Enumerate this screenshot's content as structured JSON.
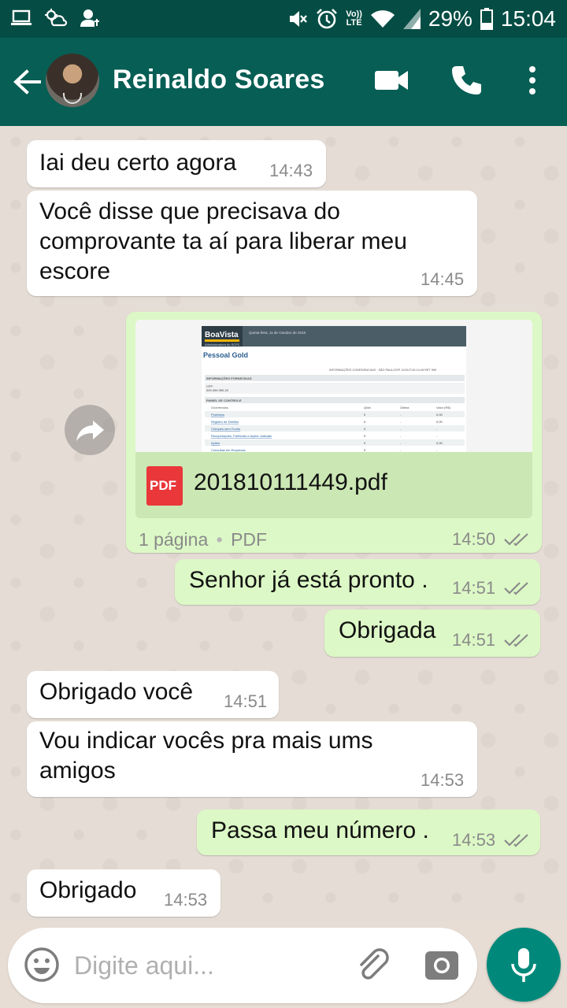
{
  "status_bar": {
    "volte_top": "Vo))",
    "volte_bottom": "LTE",
    "battery": "29%",
    "time": "15:04"
  },
  "header": {
    "contact_name": "Reinaldo Soares"
  },
  "document": {
    "file_name": "201810111449.pdf",
    "file_type_badge": "PDF",
    "meta_pages": "1 página",
    "meta_dot": "•",
    "meta_type": "PDF",
    "time": "14:50",
    "preview": {
      "brand": "BoaVista",
      "brand_sub": "Administradora do SCPC",
      "date_line": "Quinta-feira, 11 de Outubro de 2018",
      "heading": "Pessoal Gold",
      "info_line": "INFORMAÇÕES CONFIDENCIAIS · SÃO PAULO/SP 11/OUT/18 14:49 RET 999",
      "section1": "INFORMAÇÕES FORNECIDAS",
      "cpf_label": "CPF:",
      "cpf_value": "000.494.990-20",
      "section2": "PAINEL DE CONTROLE",
      "col_headers": [
        "Ocorrências",
        "Qtde.",
        "Última",
        "Valor (R$)"
      ],
      "rows": [
        [
          "Protestos",
          "0",
          "-",
          "0,00"
        ],
        [
          "Registro de Débitos",
          "0",
          "-",
          "0,00"
        ],
        [
          "Cheques sem Fundo",
          "0",
          "-",
          "-"
        ],
        [
          "Recuperações, Falências e Ações Judiciais",
          "0",
          "-",
          "-"
        ],
        [
          "Ações",
          "0",
          "-",
          "0,00"
        ],
        [
          "Consultas em Empresas",
          "0",
          "-",
          "-"
        ]
      ]
    }
  },
  "messages": [
    {
      "id": "m1",
      "dir": "in",
      "text": "Iai deu certo agora",
      "time": "14:43"
    },
    {
      "id": "m2",
      "dir": "in",
      "text": "Você disse que precisava do\ncomprovante ta aí para liberar meu\nescore",
      "time": "14:45"
    },
    {
      "id": "m3",
      "dir": "out",
      "text": "Senhor já está pronto .",
      "time": "14:51"
    },
    {
      "id": "m4",
      "dir": "out",
      "text": "Obrigada",
      "time": "14:51"
    },
    {
      "id": "m5",
      "dir": "in",
      "text": "Obrigado você",
      "time": "14:51"
    },
    {
      "id": "m6",
      "dir": "in",
      "text": "Vou indicar vocês pra mais ums\namigos",
      "time": "14:53"
    },
    {
      "id": "m7",
      "dir": "out",
      "text": "Passa meu número .",
      "time": "14:53"
    },
    {
      "id": "m8",
      "dir": "in",
      "text": "Obrigado",
      "time": "14:53"
    }
  ],
  "input": {
    "placeholder": "Digite aqui..."
  },
  "colors": {
    "status_bar": "#054d44",
    "app_bar": "#075e54",
    "outgoing_bubble": "#dcf8c6",
    "incoming_bubble": "#ffffff",
    "read_ticks": "#8a8a8a",
    "mic_button": "#00897b",
    "pdf_icon": "#e9373a"
  },
  "icons": {
    "status_left": [
      "laptop-icon",
      "weather-icon",
      "contacts-sync-icon"
    ],
    "status_right": [
      "mute-icon",
      "alarm-icon",
      "wifi-icon",
      "signal-icon",
      "battery-icon"
    ],
    "header": [
      "back-arrow-icon",
      "video-call-icon",
      "phone-icon",
      "more-vert-icon"
    ],
    "input": [
      "emoji-icon",
      "attach-icon",
      "camera-icon",
      "mic-icon"
    ],
    "forward": "forward-icon",
    "read_receipt": "double-check-icon"
  }
}
